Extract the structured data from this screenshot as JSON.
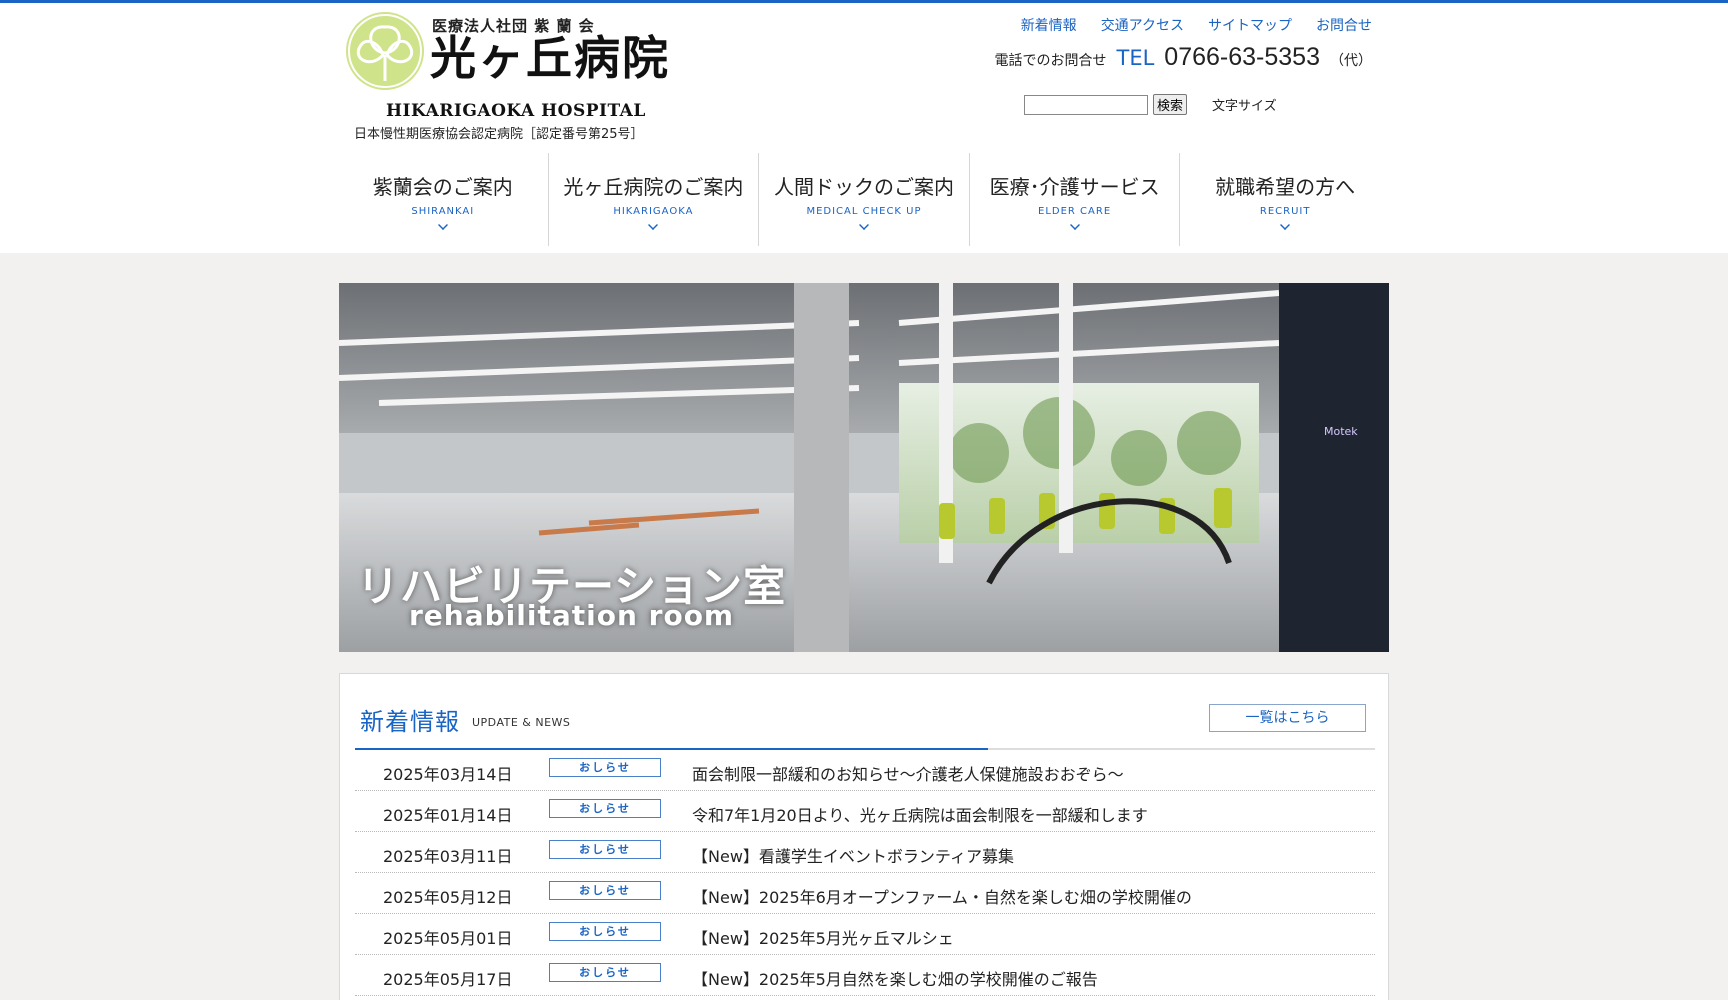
{
  "colors": {
    "accent": "#1a64c4",
    "logo_green": "#cfe38a"
  },
  "logo": {
    "corp": "医療法人社団 紫 蘭 会",
    "name": "光ヶ丘病院",
    "english": "HIKARIGAOKA HOSPITAL",
    "cert": "日本慢性期医療協会認定病院［認定番号第25号］"
  },
  "toplinks": [
    "新着情報",
    "交通アクセス",
    "サイトマップ",
    "お問合せ"
  ],
  "contact": {
    "label": "電話でのお問合せ",
    "tel_prefix": "TEL",
    "number": "0766-63-5353",
    "suffix": "（代）"
  },
  "search": {
    "button": "検索",
    "value": "",
    "fontsize_label": "文字サイズ"
  },
  "nav": [
    {
      "jp": "紫蘭会のご案内",
      "en": "SHIRANKAI"
    },
    {
      "jp": "光ヶ丘病院のご案内",
      "en": "HIKARIGAOKA"
    },
    {
      "jp": "人間ドックのご案内",
      "en": "MEDICAL CHECK UP"
    },
    {
      "jp": "医療･介護サービス",
      "en": "ELDER CARE"
    },
    {
      "jp": "就職希望の方へ",
      "en": "RECRUIT"
    }
  ],
  "hero": {
    "title_jp": "リハビリテーション室",
    "title_en": "rehabilitation room",
    "sign": "Motek"
  },
  "news": {
    "title": "新着情報",
    "subtitle": "UPDATE & NEWS",
    "more": "一覧はこちら",
    "items": [
      {
        "date": "2025年03月14日",
        "badge": "おしらせ",
        "text": "面会制限一部緩和のお知らせ～介護老人保健施設おおぞら～"
      },
      {
        "date": "2025年01月14日",
        "badge": "おしらせ",
        "text": "令和7年1月20日より、光ヶ丘病院は面会制限を一部緩和します"
      },
      {
        "date": "2025年03月11日",
        "badge": "おしらせ",
        "text": "【New】看護学生イベントボランティア募集"
      },
      {
        "date": "2025年05月12日",
        "badge": "おしらせ",
        "text": "【New】2025年6月オープンファーム・自然を楽しむ畑の学校開催の"
      },
      {
        "date": "2025年05月01日",
        "badge": "おしらせ",
        "text": "【New】2025年5月光ヶ丘マルシェ"
      },
      {
        "date": "2025年05月17日",
        "badge": "おしらせ",
        "text": "【New】2025年5月自然を楽しむ畑の学校開催のご報告"
      }
    ]
  }
}
